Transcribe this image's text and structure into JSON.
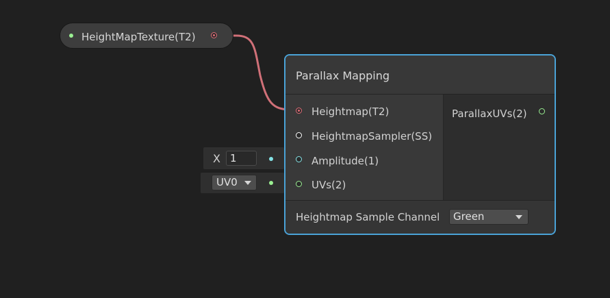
{
  "colors": {
    "background": "#202020",
    "texture_port": "#e06c76",
    "float_port": "#84e4e7",
    "vector2_port": "#9aef92",
    "sampler_port": "#ffffff",
    "selection_border": "#4aa3d8"
  },
  "property_node": {
    "label": "HeightMapTexture(T2)"
  },
  "node": {
    "title": "Parallax Mapping",
    "inputs": [
      {
        "label": "Heightmap(T2)",
        "port_type": "texture"
      },
      {
        "label": "HeightmapSampler(SS)",
        "port_type": "sampler"
      },
      {
        "label": "Amplitude(1)",
        "port_type": "float"
      },
      {
        "label": "UVs(2)",
        "port_type": "vector2"
      }
    ],
    "outputs": [
      {
        "label": "ParallaxUVs(2)",
        "port_type": "vector2"
      }
    ],
    "controls": {
      "channel_label": "Heightmap Sample Channel",
      "channel_value": "Green"
    }
  },
  "inline_inputs": {
    "amplitude": {
      "axis_label": "X",
      "value": "1"
    },
    "uvs": {
      "value": "UV0"
    }
  }
}
